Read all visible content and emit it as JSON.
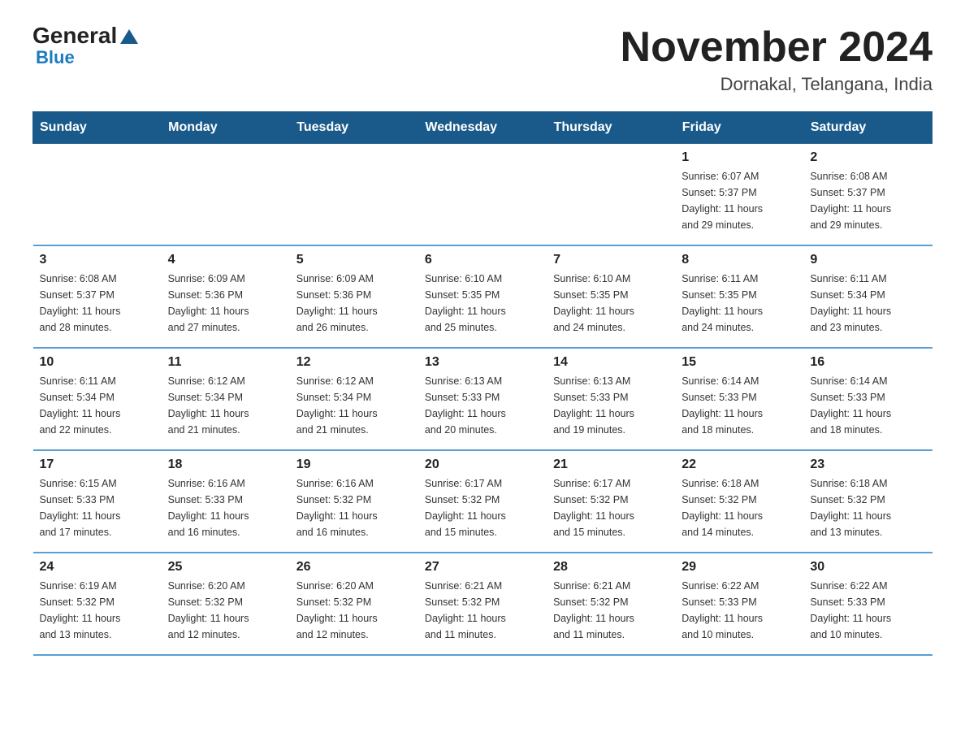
{
  "logo": {
    "general": "General",
    "blue": "Blue",
    "triangle_symbol": "▲"
  },
  "title": "November 2024",
  "subtitle": "Dornakal, Telangana, India",
  "days_of_week": [
    "Sunday",
    "Monday",
    "Tuesday",
    "Wednesday",
    "Thursday",
    "Friday",
    "Saturday"
  ],
  "weeks": [
    [
      {
        "day": "",
        "info": ""
      },
      {
        "day": "",
        "info": ""
      },
      {
        "day": "",
        "info": ""
      },
      {
        "day": "",
        "info": ""
      },
      {
        "day": "",
        "info": ""
      },
      {
        "day": "1",
        "info": "Sunrise: 6:07 AM\nSunset: 5:37 PM\nDaylight: 11 hours\nand 29 minutes."
      },
      {
        "day": "2",
        "info": "Sunrise: 6:08 AM\nSunset: 5:37 PM\nDaylight: 11 hours\nand 29 minutes."
      }
    ],
    [
      {
        "day": "3",
        "info": "Sunrise: 6:08 AM\nSunset: 5:37 PM\nDaylight: 11 hours\nand 28 minutes."
      },
      {
        "day": "4",
        "info": "Sunrise: 6:09 AM\nSunset: 5:36 PM\nDaylight: 11 hours\nand 27 minutes."
      },
      {
        "day": "5",
        "info": "Sunrise: 6:09 AM\nSunset: 5:36 PM\nDaylight: 11 hours\nand 26 minutes."
      },
      {
        "day": "6",
        "info": "Sunrise: 6:10 AM\nSunset: 5:35 PM\nDaylight: 11 hours\nand 25 minutes."
      },
      {
        "day": "7",
        "info": "Sunrise: 6:10 AM\nSunset: 5:35 PM\nDaylight: 11 hours\nand 24 minutes."
      },
      {
        "day": "8",
        "info": "Sunrise: 6:11 AM\nSunset: 5:35 PM\nDaylight: 11 hours\nand 24 minutes."
      },
      {
        "day": "9",
        "info": "Sunrise: 6:11 AM\nSunset: 5:34 PM\nDaylight: 11 hours\nand 23 minutes."
      }
    ],
    [
      {
        "day": "10",
        "info": "Sunrise: 6:11 AM\nSunset: 5:34 PM\nDaylight: 11 hours\nand 22 minutes."
      },
      {
        "day": "11",
        "info": "Sunrise: 6:12 AM\nSunset: 5:34 PM\nDaylight: 11 hours\nand 21 minutes."
      },
      {
        "day": "12",
        "info": "Sunrise: 6:12 AM\nSunset: 5:34 PM\nDaylight: 11 hours\nand 21 minutes."
      },
      {
        "day": "13",
        "info": "Sunrise: 6:13 AM\nSunset: 5:33 PM\nDaylight: 11 hours\nand 20 minutes."
      },
      {
        "day": "14",
        "info": "Sunrise: 6:13 AM\nSunset: 5:33 PM\nDaylight: 11 hours\nand 19 minutes."
      },
      {
        "day": "15",
        "info": "Sunrise: 6:14 AM\nSunset: 5:33 PM\nDaylight: 11 hours\nand 18 minutes."
      },
      {
        "day": "16",
        "info": "Sunrise: 6:14 AM\nSunset: 5:33 PM\nDaylight: 11 hours\nand 18 minutes."
      }
    ],
    [
      {
        "day": "17",
        "info": "Sunrise: 6:15 AM\nSunset: 5:33 PM\nDaylight: 11 hours\nand 17 minutes."
      },
      {
        "day": "18",
        "info": "Sunrise: 6:16 AM\nSunset: 5:33 PM\nDaylight: 11 hours\nand 16 minutes."
      },
      {
        "day": "19",
        "info": "Sunrise: 6:16 AM\nSunset: 5:32 PM\nDaylight: 11 hours\nand 16 minutes."
      },
      {
        "day": "20",
        "info": "Sunrise: 6:17 AM\nSunset: 5:32 PM\nDaylight: 11 hours\nand 15 minutes."
      },
      {
        "day": "21",
        "info": "Sunrise: 6:17 AM\nSunset: 5:32 PM\nDaylight: 11 hours\nand 15 minutes."
      },
      {
        "day": "22",
        "info": "Sunrise: 6:18 AM\nSunset: 5:32 PM\nDaylight: 11 hours\nand 14 minutes."
      },
      {
        "day": "23",
        "info": "Sunrise: 6:18 AM\nSunset: 5:32 PM\nDaylight: 11 hours\nand 13 minutes."
      }
    ],
    [
      {
        "day": "24",
        "info": "Sunrise: 6:19 AM\nSunset: 5:32 PM\nDaylight: 11 hours\nand 13 minutes."
      },
      {
        "day": "25",
        "info": "Sunrise: 6:20 AM\nSunset: 5:32 PM\nDaylight: 11 hours\nand 12 minutes."
      },
      {
        "day": "26",
        "info": "Sunrise: 6:20 AM\nSunset: 5:32 PM\nDaylight: 11 hours\nand 12 minutes."
      },
      {
        "day": "27",
        "info": "Sunrise: 6:21 AM\nSunset: 5:32 PM\nDaylight: 11 hours\nand 11 minutes."
      },
      {
        "day": "28",
        "info": "Sunrise: 6:21 AM\nSunset: 5:32 PM\nDaylight: 11 hours\nand 11 minutes."
      },
      {
        "day": "29",
        "info": "Sunrise: 6:22 AM\nSunset: 5:33 PM\nDaylight: 11 hours\nand 10 minutes."
      },
      {
        "day": "30",
        "info": "Sunrise: 6:22 AM\nSunset: 5:33 PM\nDaylight: 11 hours\nand 10 minutes."
      }
    ]
  ]
}
